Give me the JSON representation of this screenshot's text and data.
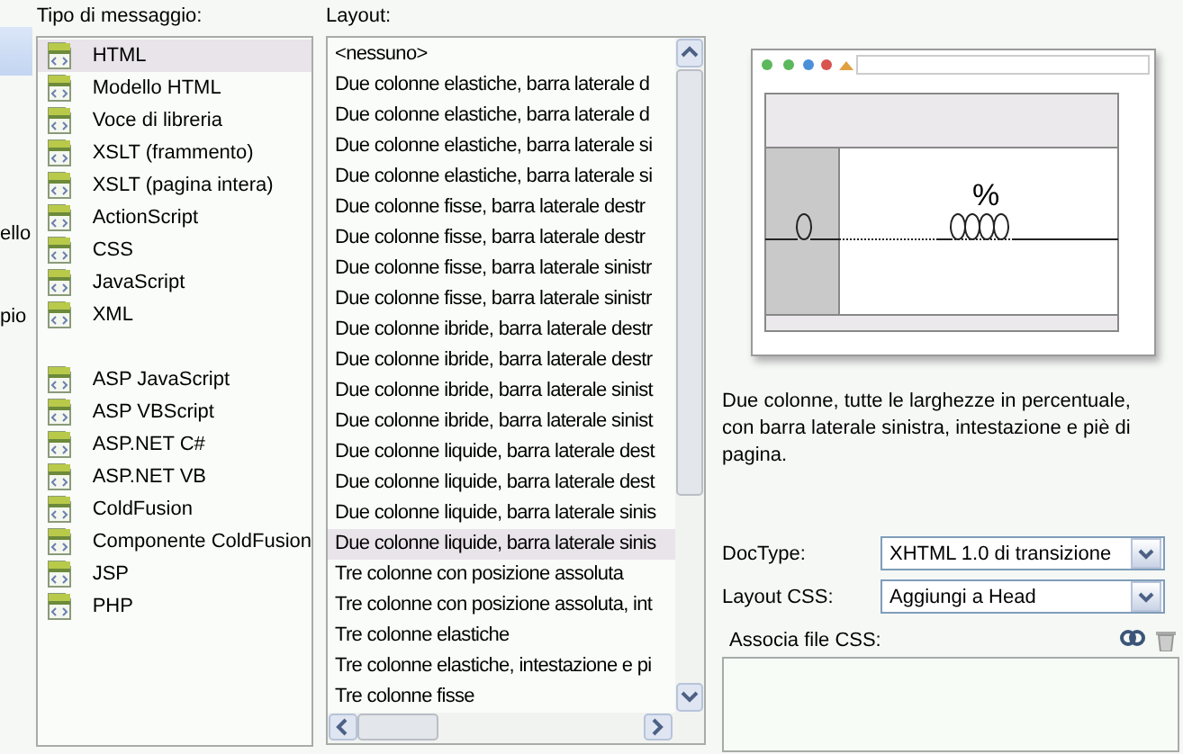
{
  "categories": [
    {
      "label": "ello"
    },
    {
      "label": "pio"
    }
  ],
  "message_types": {
    "label": "Tipo di messaggio:",
    "items": [
      {
        "label": "HTML",
        "selected": true
      },
      {
        "label": "Modello HTML",
        "selected": false
      },
      {
        "label": "Voce di libreria",
        "selected": false
      },
      {
        "label": "XSLT (frammento)",
        "selected": false
      },
      {
        "label": "XSLT (pagina intera)",
        "selected": false
      },
      {
        "label": "ActionScript",
        "selected": false
      },
      {
        "label": "CSS",
        "selected": false
      },
      {
        "label": "JavaScript",
        "selected": false
      },
      {
        "label": "XML",
        "selected": false
      },
      {
        "kind": "spacer"
      },
      {
        "label": "ASP JavaScript",
        "selected": false
      },
      {
        "label": "ASP VBScript",
        "selected": false
      },
      {
        "label": "ASP.NET C#",
        "selected": false
      },
      {
        "label": "ASP.NET VB",
        "selected": false
      },
      {
        "label": "ColdFusion",
        "selected": false
      },
      {
        "label": "Componente ColdFusion",
        "selected": false
      },
      {
        "label": "JSP",
        "selected": false
      },
      {
        "label": "PHP",
        "selected": false
      }
    ]
  },
  "layouts": {
    "label": "Layout:",
    "items": [
      {
        "label": "<nessuno>",
        "selected": false
      },
      {
        "label": "Due colonne elastiche, barra laterale d",
        "selected": false
      },
      {
        "label": "Due colonne elastiche, barra laterale d",
        "selected": false
      },
      {
        "label": "Due colonne elastiche, barra laterale si",
        "selected": false
      },
      {
        "label": "Due colonne elastiche, barra laterale si",
        "selected": false
      },
      {
        "label": "Due colonne fisse, barra laterale destr",
        "selected": false
      },
      {
        "label": "Due colonne fisse, barra laterale destr",
        "selected": false
      },
      {
        "label": "Due colonne fisse, barra laterale sinistr",
        "selected": false
      },
      {
        "label": "Due colonne fisse, barra laterale sinistr",
        "selected": false
      },
      {
        "label": "Due colonne ibride, barra laterale destr",
        "selected": false
      },
      {
        "label": "Due colonne ibride, barra laterale destr",
        "selected": false
      },
      {
        "label": "Due colonne ibride, barra laterale sinist",
        "selected": false
      },
      {
        "label": "Due colonne ibride, barra laterale sinist",
        "selected": false
      },
      {
        "label": "Due colonne liquide, barra laterale dest",
        "selected": false
      },
      {
        "label": "Due colonne liquide, barra laterale dest",
        "selected": false
      },
      {
        "label": "Due colonne liquide, barra laterale sinis",
        "selected": false
      },
      {
        "label": "Due colonne liquide, barra laterale sinis",
        "selected": true
      },
      {
        "label": "Tre colonne con posizione assoluta",
        "selected": false
      },
      {
        "label": "Tre colonne con posizione assoluta, int",
        "selected": false
      },
      {
        "label": "Tre colonne elastiche",
        "selected": false
      },
      {
        "label": "Tre colonne elastiche, intestazione e pi",
        "selected": false
      },
      {
        "label": "Tre colonne fisse",
        "selected": false
      }
    ]
  },
  "preview": {
    "symbol": "%",
    "description": "Due colonne, tutte le larghezze in percentuale, con barra laterale sinistra, intestazione e piè di pagina."
  },
  "doctype": {
    "label": "DocType:",
    "value": "XHTML 1.0 di transizione"
  },
  "layout_css": {
    "label": "Layout CSS:",
    "value": "Aggiungi a Head"
  },
  "attach_css": {
    "label": "Associa file CSS:"
  }
}
